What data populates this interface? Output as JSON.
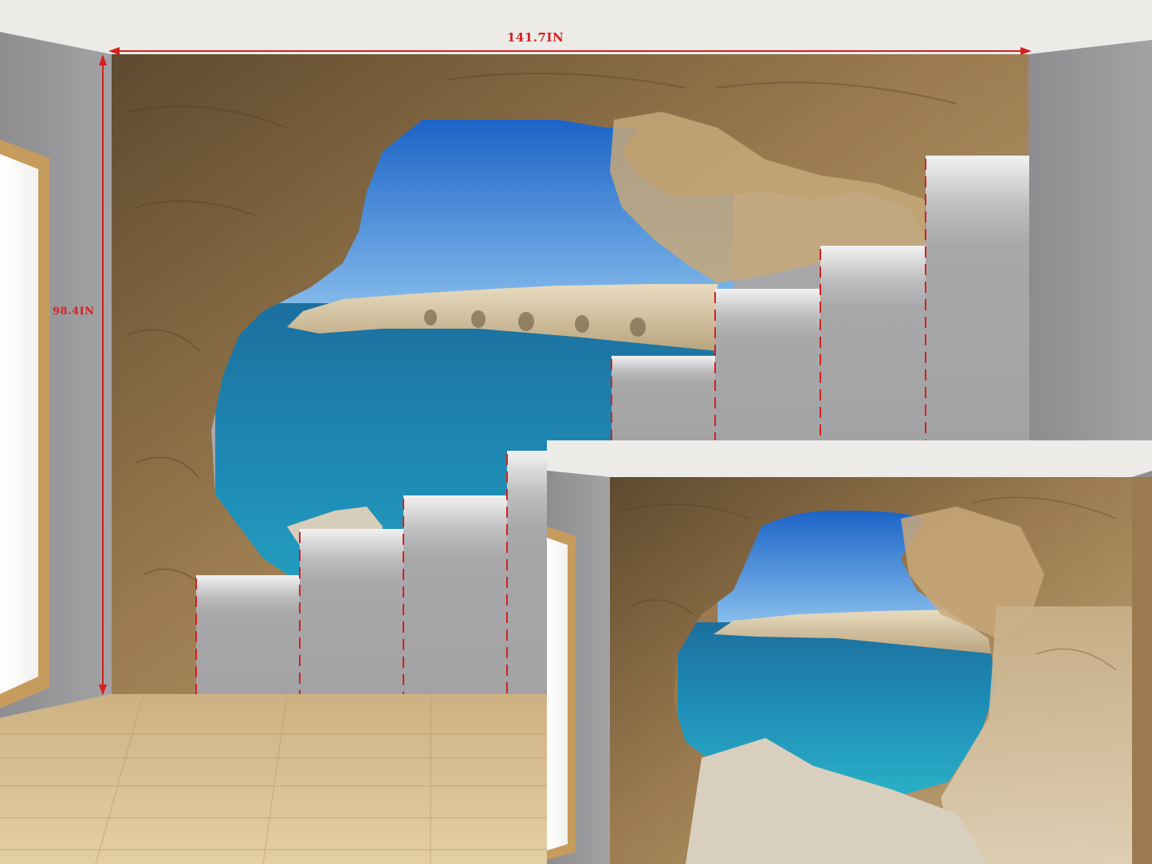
{
  "dimensions": {
    "width_label": "141.7IN",
    "height_label": "98.4IN"
  },
  "colors": {
    "dimension_marker": "#d42020",
    "sea": "#1f8fb8",
    "sky": "#2f7fd6",
    "rock": "#9a7a4e",
    "floor": "#d9bf90",
    "panel": "#a9a9ab"
  }
}
